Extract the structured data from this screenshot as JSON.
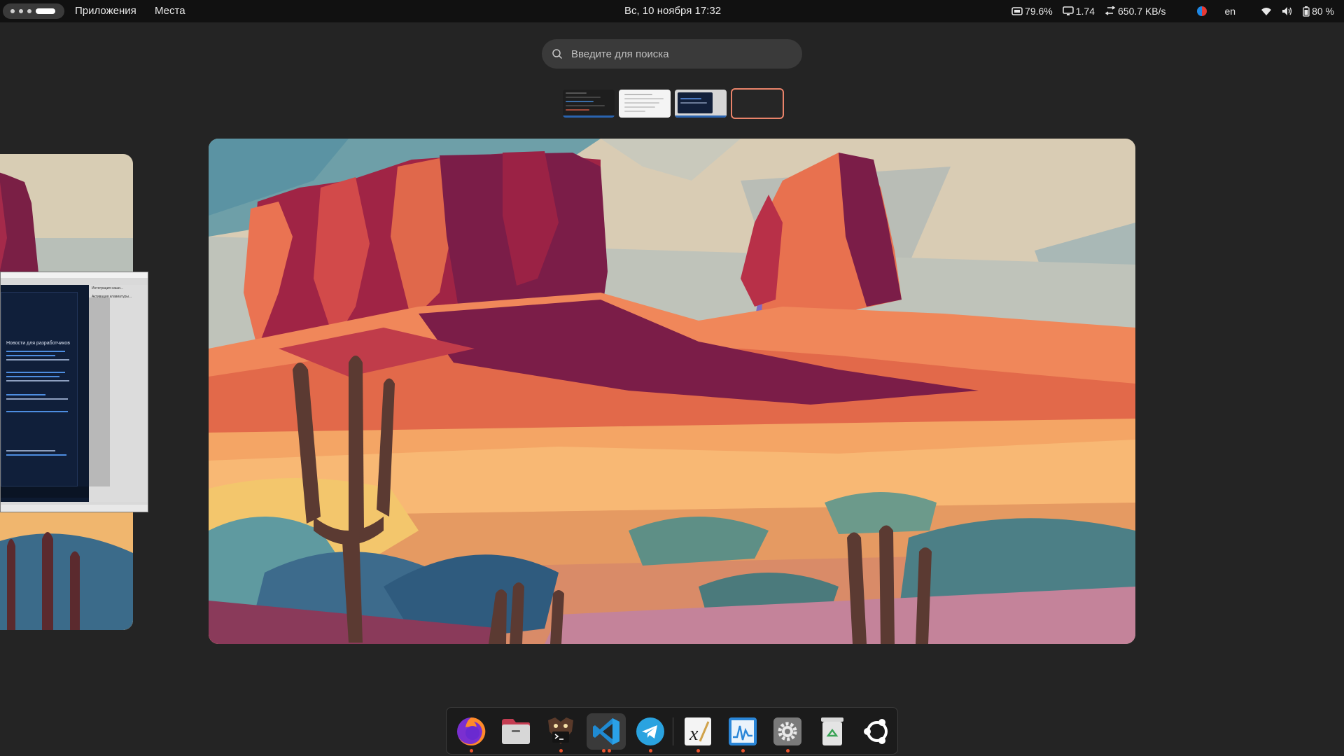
{
  "topbar": {
    "menu_apps": "Приложения",
    "menu_places": "Места",
    "clock": "Вс, 10 ноября  17:32",
    "cpu": "79.6%",
    "load": "1.74",
    "network": "650.7 KB/s",
    "lang": "en",
    "battery": "80 %"
  },
  "search": {
    "placeholder": "Введите для поиска"
  },
  "workspaces": {
    "count": 4,
    "active_index": 3
  },
  "mini_window": {
    "heading": "Новости для разработчиков",
    "sidebar_item_1": "Интеграция наши...",
    "sidebar_item_2": "Активация клавиатуры..."
  },
  "dock": {
    "apps": [
      "firefox",
      "files",
      "terminal",
      "vscode",
      "telegram",
      "xournal",
      "system-monitor",
      "settings",
      "trash",
      "ubuntu"
    ],
    "running": [
      "firefox",
      "terminal",
      "vscode",
      "telegram",
      "xournal",
      "system-monitor",
      "settings"
    ]
  },
  "colors": {
    "accent": "#e9836a",
    "running_dot": "#e9522c",
    "panel": "#111111",
    "background": "#242424"
  }
}
